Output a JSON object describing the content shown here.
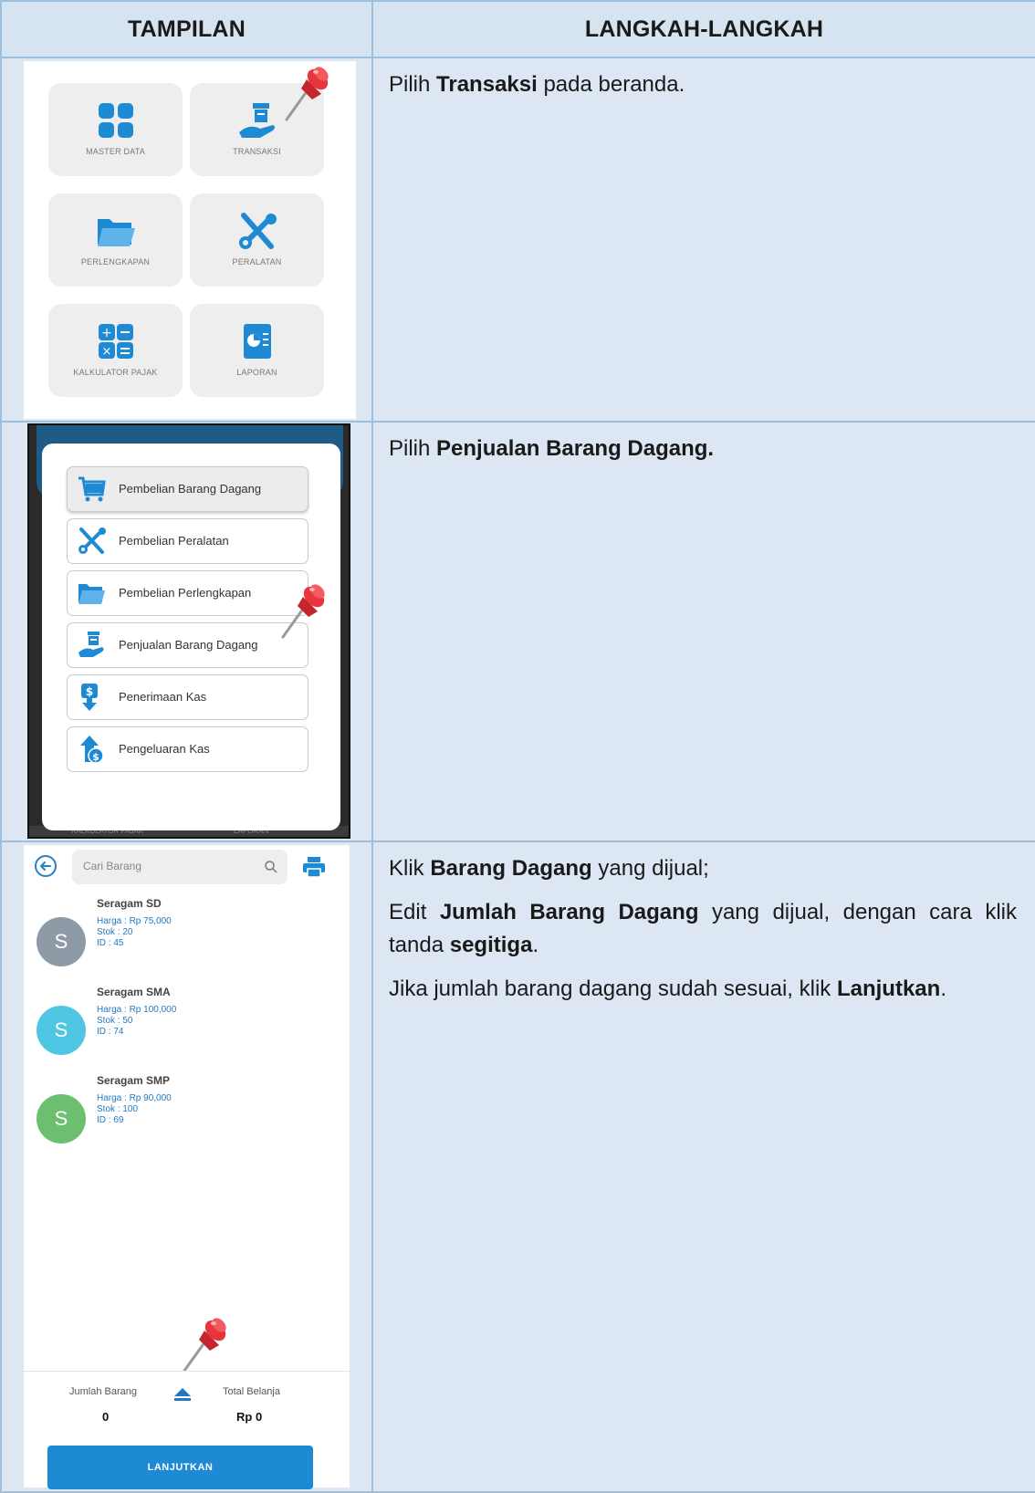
{
  "headers": {
    "left": "TAMPILAN",
    "right": "LANGKAH-LANGKAH"
  },
  "steps": {
    "step1": {
      "prefix": "Pilih ",
      "bold": "Transaksi",
      "suffix": " pada beranda."
    },
    "step2": {
      "prefix": "Pilih ",
      "bold": "Penjualan Barang Dagang."
    },
    "step3": {
      "p1": {
        "a": "Klik ",
        "b": "Barang Dagang",
        "c": " yang dijual;"
      },
      "p2": {
        "a": "Edit ",
        "b": "Jumlah Barang Dagang",
        "c": " yang dijual, dengan cara klik tanda ",
        "d": "segitiga",
        "e": "."
      },
      "p3": {
        "a": "Jika jumlah barang dagang sudah sesuai, klik ",
        "b": "Lanjutkan",
        "c": "."
      }
    }
  },
  "menu_screen": {
    "tiles": [
      {
        "label": "MASTER DATA",
        "icon": "grid-icon"
      },
      {
        "label": "TRANSAKSI",
        "icon": "hand-box-icon"
      },
      {
        "label": "PERLENGKAPAN",
        "icon": "folder-icon"
      },
      {
        "label": "PERALATAN",
        "icon": "tools-icon"
      },
      {
        "label": "KALKULATOR PAJAK",
        "icon": "calculator-icon"
      },
      {
        "label": "LAPORAN",
        "icon": "report-icon"
      }
    ]
  },
  "dialog_screen": {
    "items": [
      {
        "label": "Pembelian Barang Dagang",
        "icon": "cart-icon"
      },
      {
        "label": "Pembelian Peralatan",
        "icon": "tools-icon"
      },
      {
        "label": "Pembelian Perlengkapan",
        "icon": "folder-icon"
      },
      {
        "label": "Penjualan Barang Dagang",
        "icon": "hand-box-icon"
      },
      {
        "label": "Penerimaan Kas",
        "icon": "cash-in-icon"
      },
      {
        "label": "Pengeluaran Kas",
        "icon": "cash-out-icon"
      }
    ],
    "bg_labels": {
      "left": "KALKULATOR PAJAK",
      "right": "LAPORAN"
    }
  },
  "list_screen": {
    "search_placeholder": "Cari Barang",
    "products": [
      {
        "initial": "S",
        "name": "Seragam SD",
        "harga": "Harga : Rp 75,000",
        "stok": "Stok : 20",
        "id": "ID : 45",
        "color": "#8e9aa5"
      },
      {
        "initial": "S",
        "name": "Seragam SMA",
        "harga": "Harga : Rp 100,000",
        "stok": "Stok : 50",
        "id": "ID : 74",
        "color": "#4fc7e4"
      },
      {
        "initial": "S",
        "name": "Seragam SMP",
        "harga": "Harga : Rp 90,000",
        "stok": "Stok : 100",
        "id": "ID : 69",
        "color": "#6cbf6e"
      }
    ],
    "footer": {
      "jumlah_label": "Jumlah Barang",
      "jumlah_value": "0",
      "total_label": "Total Belanja",
      "total_value": "Rp 0",
      "button": "LANJUTKAN"
    }
  },
  "colors": {
    "table_bg": "#dce7f3",
    "border": "#9fbfdc",
    "accent": "#1f8ad4",
    "pin": "#e8343c"
  }
}
